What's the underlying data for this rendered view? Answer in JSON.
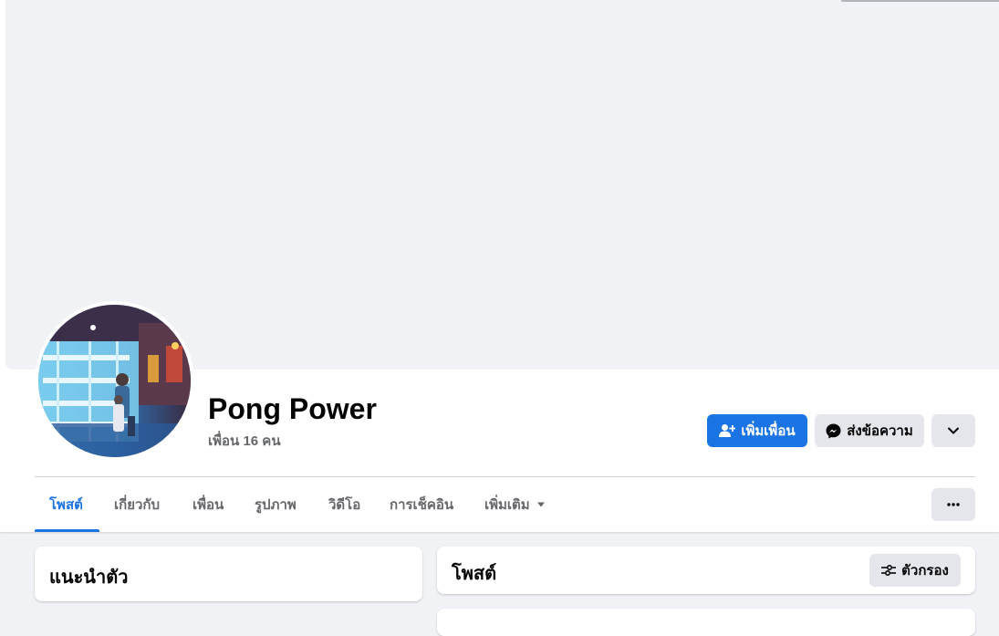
{
  "profile": {
    "name": "Pong Power",
    "friend_count": "เพื่อน 16 คน"
  },
  "actions": {
    "add_friend": "เพิ่มเพื่อน",
    "message": "ส่งข้อความ"
  },
  "tabs": [
    {
      "label": "โพสต์",
      "active": true
    },
    {
      "label": "เกี่ยวกับ",
      "active": false
    },
    {
      "label": "เพื่อน",
      "active": false
    },
    {
      "label": "รูปภาพ",
      "active": false
    },
    {
      "label": "วิดีโอ",
      "active": false
    },
    {
      "label": "การเช็คอิน",
      "active": false
    },
    {
      "label": "เพิ่มเติม",
      "active": false
    }
  ],
  "intro": {
    "title": "แนะนำตัว"
  },
  "posts": {
    "title": "โพสต์",
    "filter_label": "ตัวกรอง"
  },
  "colors": {
    "accent": "#1b74e4",
    "background": "#f0f2f5",
    "secondary_button": "#e4e6eb",
    "secondary_text": "#65676b"
  },
  "icons": [
    "add-friend-icon",
    "messenger-icon",
    "chevron-down-icon",
    "dropdown-caret-icon",
    "more-dots-icon",
    "filter-icon"
  ]
}
